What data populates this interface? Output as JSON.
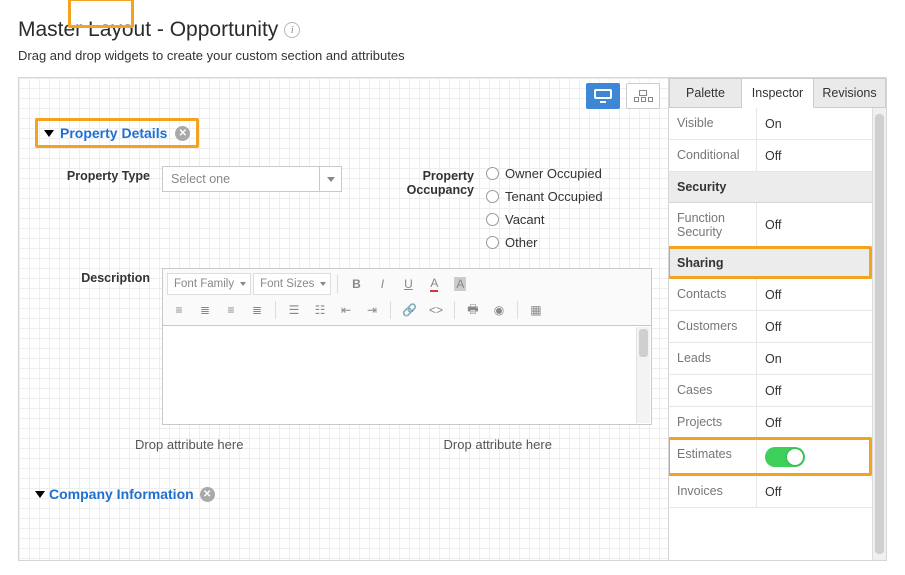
{
  "page_title": "Master Layout - Opportunity",
  "subtitle": "Drag and drop widgets to create your custom section and attributes",
  "section1": {
    "title": "Property Details",
    "prop_type_label": "Property Type",
    "select_placeholder": "Select one",
    "occupancy_label": "Property Occupancy",
    "occupancy_options": [
      "Owner Occupied",
      "Tenant Occupied",
      "Vacant",
      "Other"
    ],
    "description_label": "Description",
    "font_family_label": "Font Family",
    "font_sizes_label": "Font Sizes",
    "drop_hint": "Drop attribute here"
  },
  "section2": {
    "title": "Company Information"
  },
  "tabs": {
    "palette": "Palette",
    "inspector": "Inspector",
    "revisions": "Revisions"
  },
  "inspector": {
    "visible": {
      "k": "Visible",
      "v": "On"
    },
    "conditional": {
      "k": "Conditional",
      "v": "Off"
    },
    "security_head": "Security",
    "function_security": {
      "k": "Function Security",
      "v": "Off"
    },
    "sharing_head": "Sharing",
    "rows": [
      {
        "k": "Contacts",
        "v": "Off"
      },
      {
        "k": "Customers",
        "v": "Off"
      },
      {
        "k": "Leads",
        "v": "On"
      },
      {
        "k": "Cases",
        "v": "Off"
      },
      {
        "k": "Projects",
        "v": "Off"
      },
      {
        "k": "Estimates",
        "v": "__toggle_on__"
      },
      {
        "k": "Invoices",
        "v": "Off"
      }
    ]
  }
}
